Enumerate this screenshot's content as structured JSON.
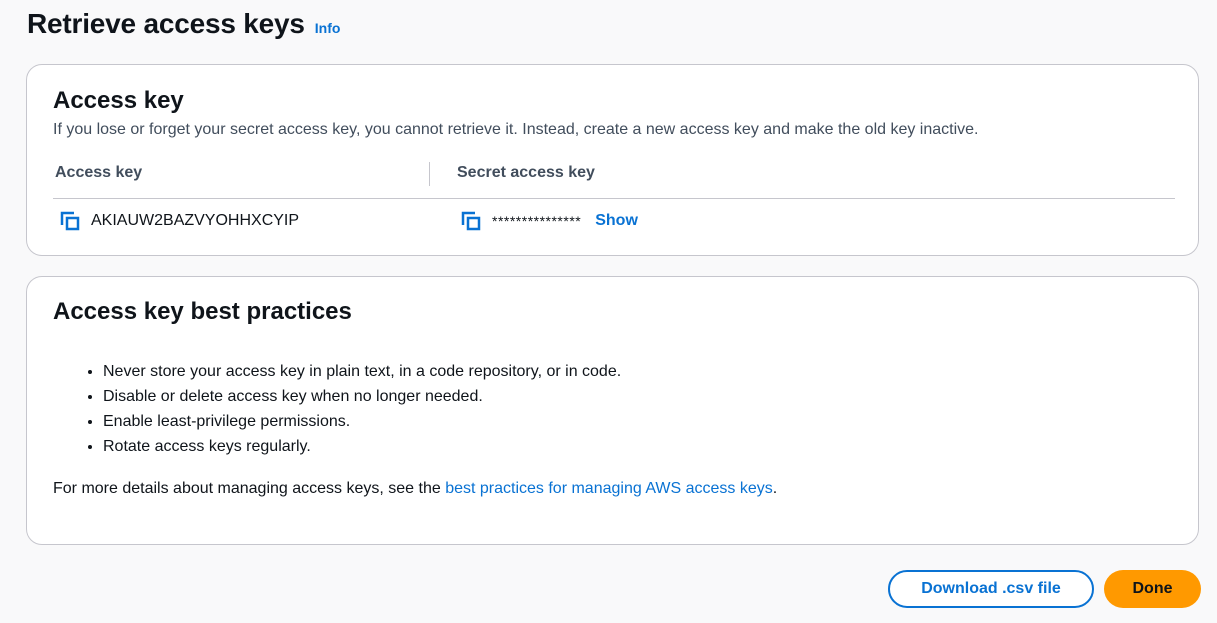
{
  "page": {
    "title": "Retrieve access keys",
    "info_label": "Info"
  },
  "access_key_panel": {
    "title": "Access key",
    "description": "If you lose or forget your secret access key, you cannot retrieve it. Instead, create a new access key and make the old key inactive.",
    "columns": [
      "Access key",
      "Secret access key"
    ],
    "access_key_value": "AKIAUW2BAZVYOHHXCYIP",
    "secret_mask": "***************",
    "show_label": "Show",
    "icons": {
      "copy": "copy-icon"
    }
  },
  "best_practices_panel": {
    "title": "Access key best practices",
    "items": [
      "Never store your access key in plain text, in a code repository, or in code.",
      "Disable or delete access key when no longer needed.",
      "Enable least-privilege permissions.",
      "Rotate access keys regularly."
    ],
    "footer_prefix": "For more details about managing access keys, see the ",
    "footer_link": "best practices for managing AWS access keys",
    "footer_suffix": "."
  },
  "actions": {
    "download_label": "Download .csv file",
    "done_label": "Done"
  },
  "colors": {
    "link": "#0972d3",
    "primary_button": "#ff9900",
    "border": "#c6c6cd",
    "background": "#f9f9fa"
  }
}
